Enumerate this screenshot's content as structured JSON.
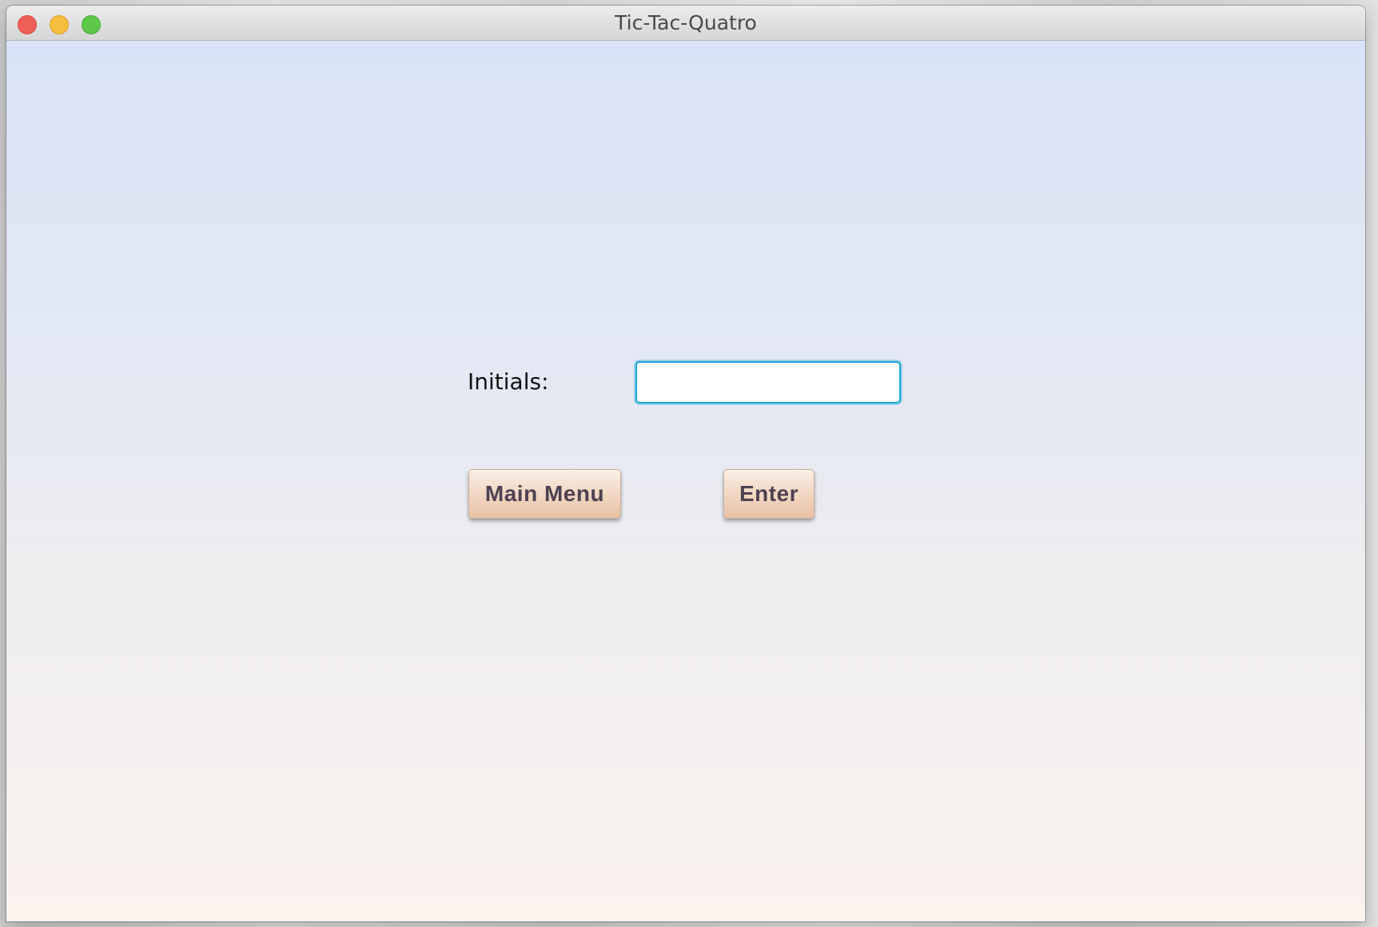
{
  "window": {
    "title": "Tic-Tac-Quatro"
  },
  "form": {
    "initials_label": "Initials:",
    "initials_value": "",
    "initials_placeholder": ""
  },
  "buttons": {
    "main_menu_label": "Main Menu",
    "enter_label": "Enter"
  },
  "colors": {
    "input_focus_border": "#1aa6d9",
    "button_text": "#4d4250",
    "button_top": "#fbeee4",
    "button_bottom": "#e9c1a3",
    "background_top": "#d8e3f7",
    "background_bottom": "#fbf3ee"
  },
  "icons": {
    "close": "close-traffic-light-icon",
    "minimize": "minimize-traffic-light-icon",
    "zoom": "zoom-traffic-light-icon"
  }
}
